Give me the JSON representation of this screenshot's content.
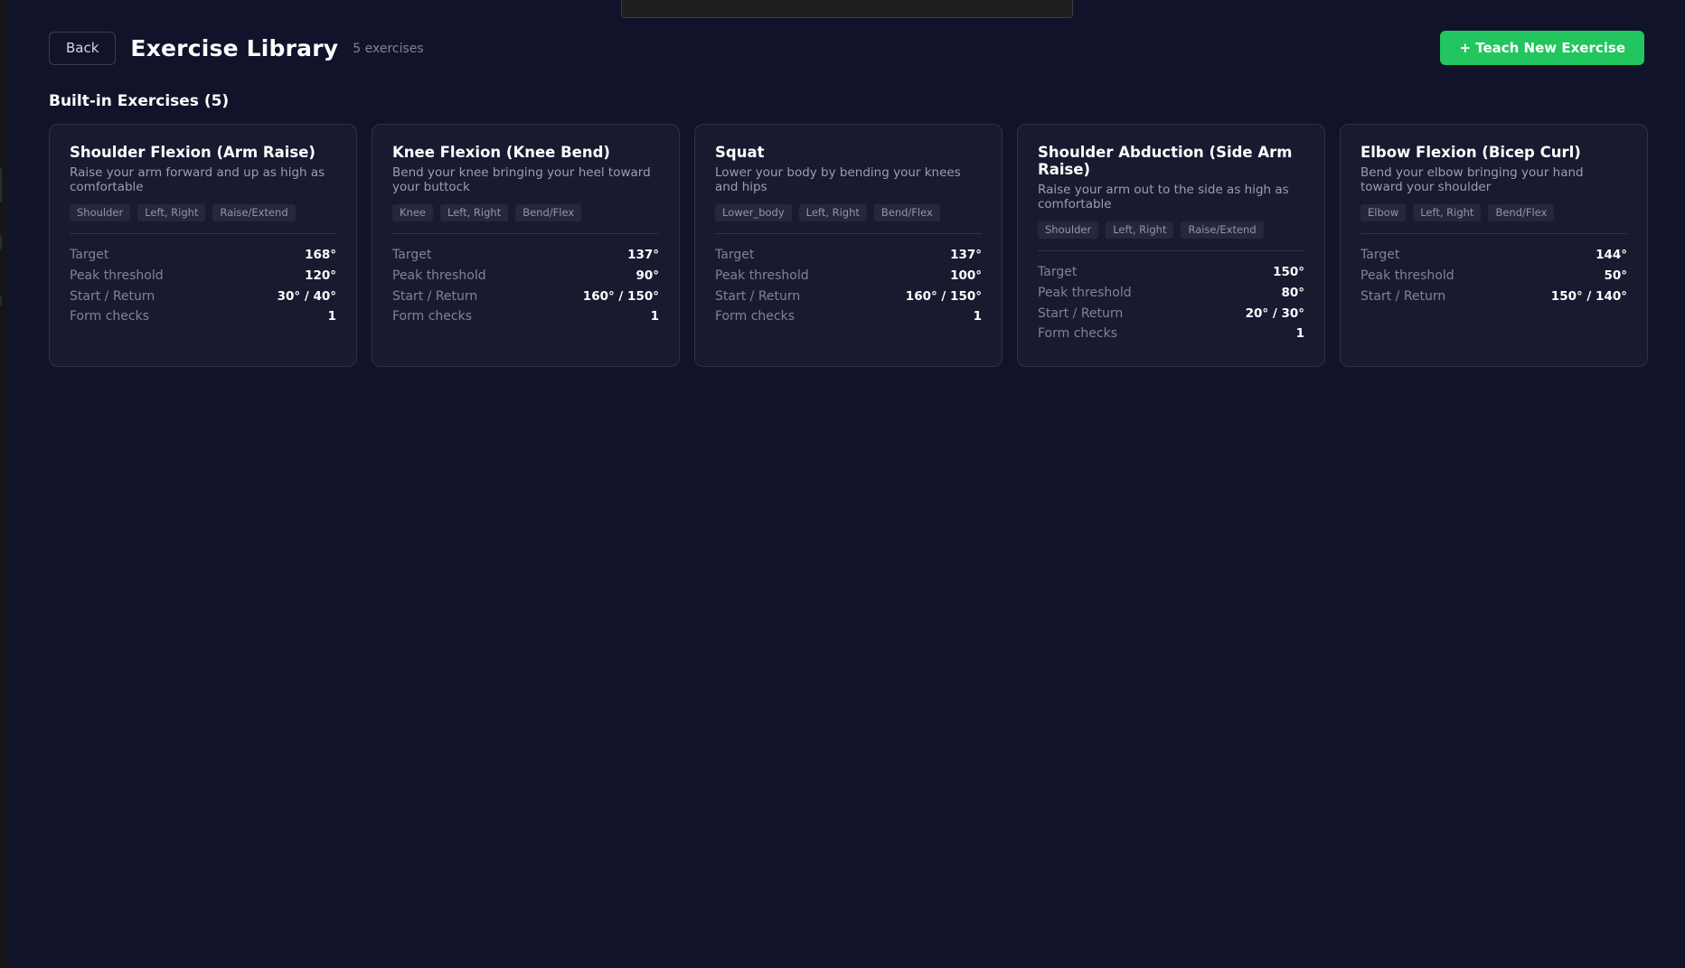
{
  "header": {
    "back_label": "Back",
    "title": "Exercise Library",
    "count": "5 exercises",
    "teach_label": "+ Teach New Exercise"
  },
  "section": {
    "heading": "Built-in Exercises (5)"
  },
  "stat_labels": {
    "target": "Target",
    "peak": "Peak threshold",
    "start_return": "Start / Return",
    "form_checks": "Form checks"
  },
  "exercises": [
    {
      "title": "Shoulder Flexion (Arm Raise)",
      "description": "Raise your arm forward and up as high as comfortable",
      "tags": [
        "Shoulder",
        "Left, Right",
        "Raise/Extend"
      ],
      "target": "168°",
      "peak": "120°",
      "start_return": "30° / 40°",
      "form_checks": "1"
    },
    {
      "title": "Knee Flexion (Knee Bend)",
      "description": "Bend your knee bringing your heel toward your buttock",
      "tags": [
        "Knee",
        "Left, Right",
        "Bend/Flex"
      ],
      "target": "137°",
      "peak": "90°",
      "start_return": "160° / 150°",
      "form_checks": "1"
    },
    {
      "title": "Squat",
      "description": "Lower your body by bending your knees and hips",
      "tags": [
        "Lower_body",
        "Left, Right",
        "Bend/Flex"
      ],
      "target": "137°",
      "peak": "100°",
      "start_return": "160° / 150°",
      "form_checks": "1"
    },
    {
      "title": "Shoulder Abduction (Side Arm Raise)",
      "description": "Raise your arm out to the side as high as comfortable",
      "tags": [
        "Shoulder",
        "Left, Right",
        "Raise/Extend"
      ],
      "target": "150°",
      "peak": "80°",
      "start_return": "20° / 30°",
      "form_checks": "1"
    },
    {
      "title": "Elbow Flexion (Bicep Curl)",
      "description": "Bend your elbow bringing your hand toward your shoulder",
      "tags": [
        "Elbow",
        "Left, Right",
        "Bend/Flex"
      ],
      "target": "144°",
      "peak": "50°",
      "start_return": "150° / 140°",
      "form_checks": null
    }
  ]
}
